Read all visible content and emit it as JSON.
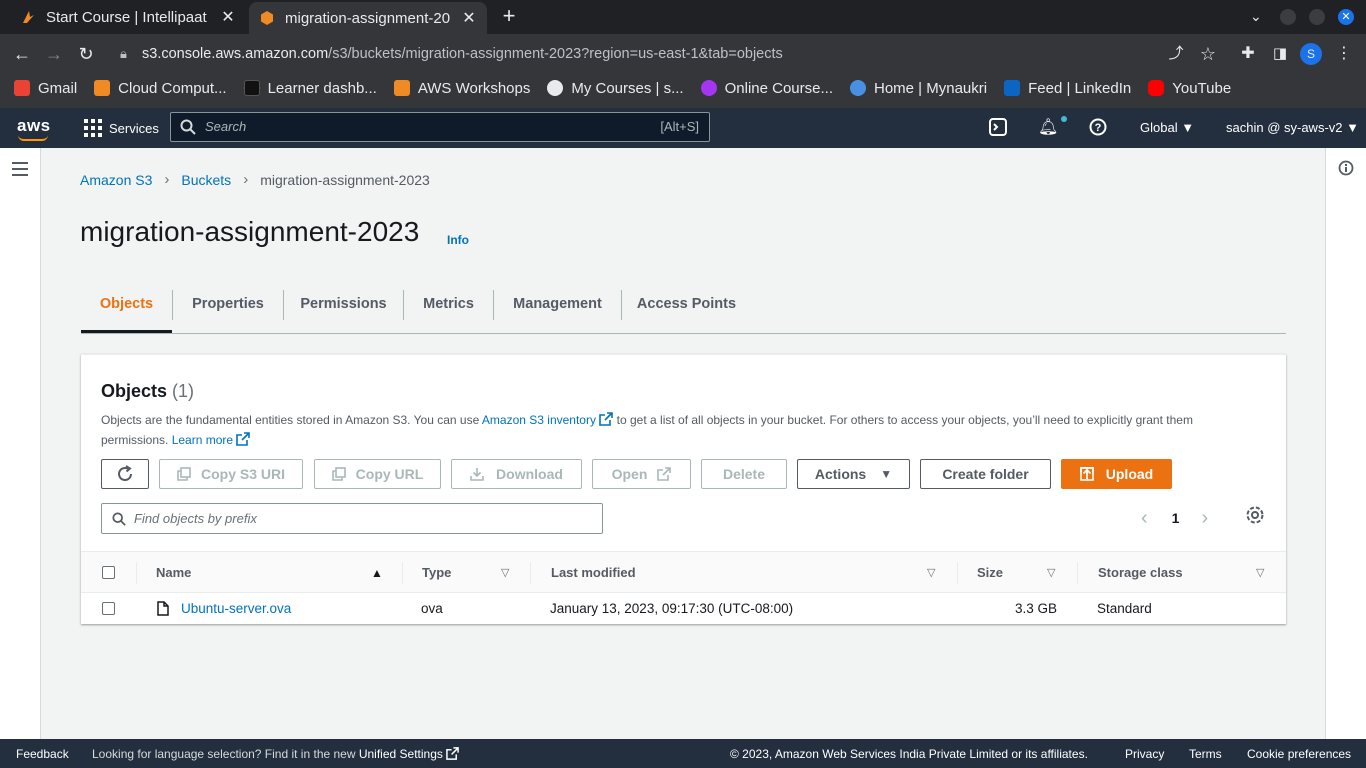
{
  "browser": {
    "tabs": [
      {
        "title": "Start Course | Intellipaat",
        "close": "✕"
      },
      {
        "title": "migration-assignment-20",
        "close": "✕"
      }
    ],
    "newtab": "+",
    "url_host": "s3.console.aws.amazon.com",
    "url_path": "/s3/buckets/migration-assignment-2023?region=us-east-1&tab=objects",
    "profile_initial": "S",
    "bookmarks": [
      {
        "label": "Gmail",
        "color": "#ea4335"
      },
      {
        "label": "Cloud Comput...",
        "color": "#f08a24"
      },
      {
        "label": "Learner dashb...",
        "color": "#111111"
      },
      {
        "label": "AWS Workshops",
        "color": "#f08a24"
      },
      {
        "label": "My Courses | s...",
        "color": "#e8eaed"
      },
      {
        "label": "Online Course...",
        "color": "#a435f0"
      },
      {
        "label": "Home | Mynaukri",
        "color": "#4a90e2"
      },
      {
        "label": "Feed | LinkedIn",
        "color": "#0a66c2"
      },
      {
        "label": "YouTube",
        "color": "#ff0000"
      }
    ],
    "more_bookmarks": "»"
  },
  "aws": {
    "logo": "aws",
    "services": "Services",
    "search_placeholder": "Search",
    "search_shortcut": "[Alt+S]",
    "region": "Global ▼",
    "account": "sachin @ sy-aws-v2 ▼"
  },
  "breadcrumb": {
    "items": [
      "Amazon S3",
      "Buckets",
      "migration-assignment-2023"
    ],
    "separator": "›"
  },
  "page": {
    "title": "migration-assignment-2023",
    "info": "Info"
  },
  "tabs": [
    "Objects",
    "Properties",
    "Permissions",
    "Metrics",
    "Management",
    "Access Points"
  ],
  "objects": {
    "heading": "Objects",
    "count": "(1)",
    "desc_1": "Objects are the fundamental entities stored in Amazon S3. You can use ",
    "desc_link": "Amazon S3 inventory",
    "desc_2": " to get a list of all objects in your bucket. For others to access your objects, you’ll need to explicitly grant them permissions. ",
    "learn_more": "Learn more",
    "buttons": {
      "copy_s3_uri": "Copy S3 URI",
      "copy_url": "Copy URL",
      "download": "Download",
      "open": "Open",
      "delete": "Delete",
      "actions": "Actions",
      "create_folder": "Create folder",
      "upload": "Upload"
    },
    "prefix_placeholder": "Find objects by prefix",
    "page_number": "1",
    "columns": [
      "Name",
      "Type",
      "Last modified",
      "Size",
      "Storage class"
    ],
    "rows": [
      {
        "name": "Ubuntu-server.ova",
        "type": "ova",
        "last_modified": "January 13, 2023, 09:17:30 (UTC-08:00)",
        "size": "3.3 GB",
        "storage_class": "Standard"
      }
    ]
  },
  "footer": {
    "feedback": "Feedback",
    "lang": "Looking for language selection? Find it in the new ",
    "unified": "Unified Settings",
    "copyright": "© 2023, Amazon Web Services India Private Limited or its affiliates.",
    "privacy": "Privacy",
    "terms": "Terms",
    "cookies": "Cookie preferences"
  },
  "colors": {
    "aws_orange": "#ec7211",
    "aws_link": "#0073bb",
    "aws_nav": "#232f3e"
  }
}
